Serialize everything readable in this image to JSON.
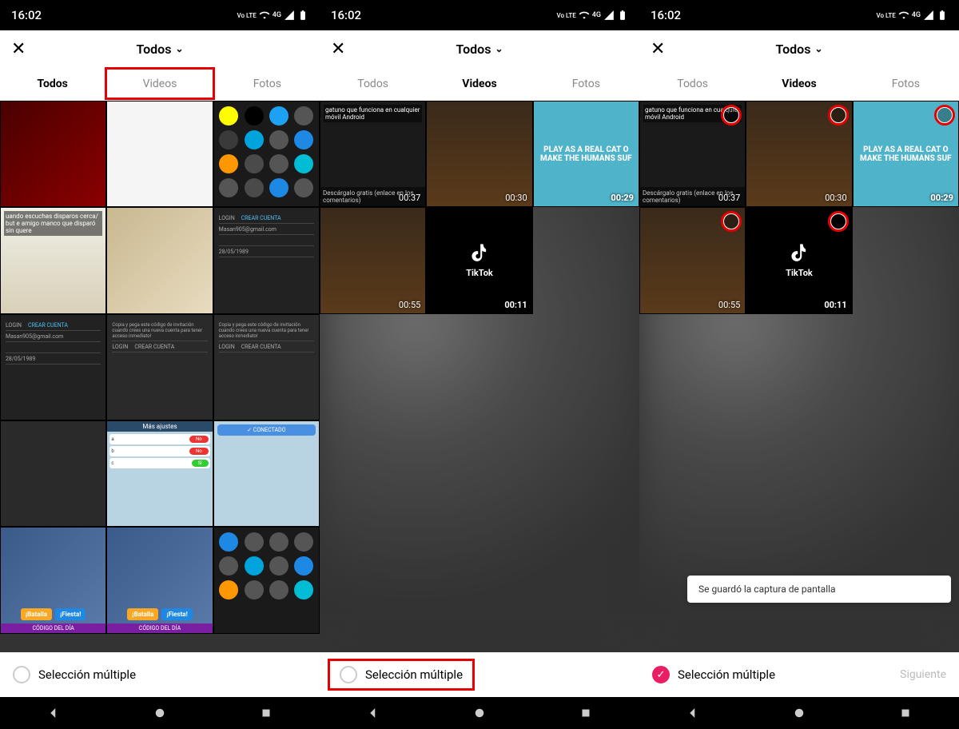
{
  "status": {
    "time": "16:02",
    "lte": "Vo LTE",
    "net": "4G"
  },
  "header": {
    "close": "✕",
    "title": "Todos",
    "chevron": "⌄"
  },
  "tabs": {
    "todos": "Todos",
    "videos": "Videos",
    "fotos": "Fotos"
  },
  "bottom": {
    "multi_select": "Selección múltiple",
    "siguiente": "Siguiente",
    "toast": "Se guardó la captura de pantalla"
  },
  "durations": {
    "v1": "00:37",
    "v2": "00:30",
    "v3": "00:29",
    "v4": "00:55",
    "v5": "00:11"
  },
  "text": {
    "cat": "PLAY AS A REAL CAT O MAKE THE HUMANS SUF",
    "tiktok": "TikTok",
    "hamster": "uando escuchas disparos cerca/ but e amigo manco que disparó sin quere",
    "gatuno": "gatuno que funciona en cualquier móvil Android",
    "descarga": "Descárgalo gratis (enlace en los comentarios)",
    "login": "LOGIN",
    "crear": "CREAR CUENTA",
    "email": "Masan905@gmail.com",
    "date": "28/05/1989",
    "conectado": "CONECTADO",
    "mas_ajustes": "Más ajustes",
    "codigo": "CÓDIGO DEL DÍA",
    "batalla": "¡Batalla",
    "fiesta": "¡Fiesta!",
    "copy_code": "Copia y pega este código de invitación cuando crees una nueva cuenta para tener acceso inmediato!"
  },
  "check": "✓"
}
